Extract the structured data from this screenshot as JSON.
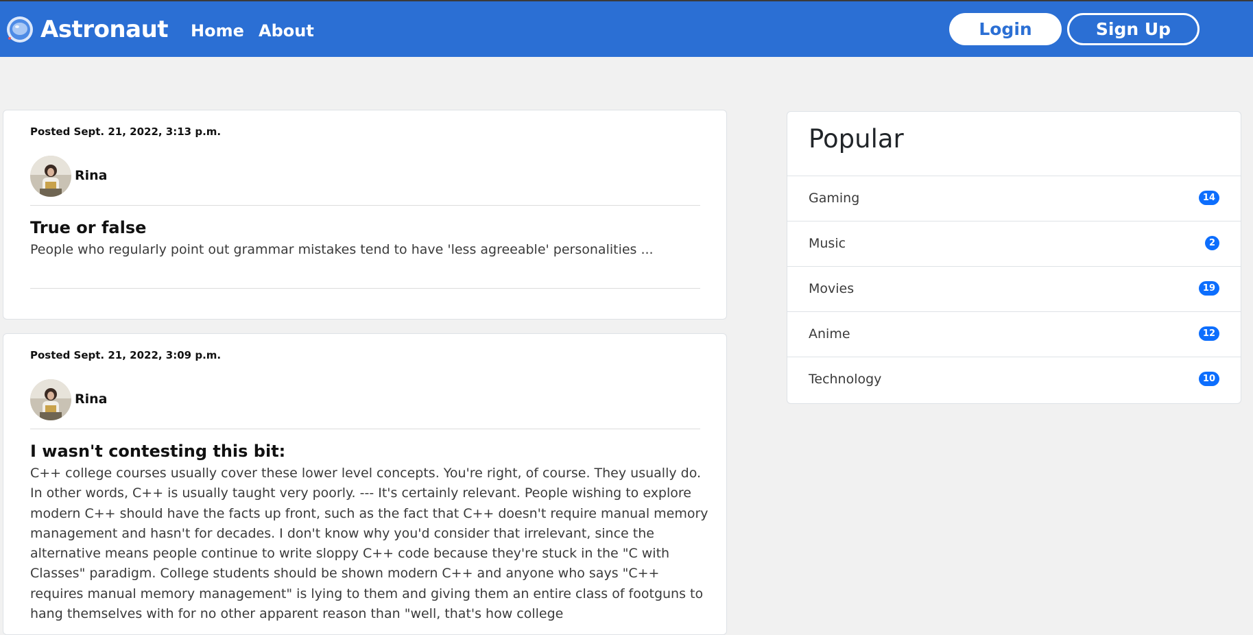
{
  "app": {
    "name": "Astronaut"
  },
  "nav": {
    "links": [
      "Home",
      "About"
    ],
    "login_label": "Login",
    "signup_label": "Sign Up"
  },
  "posts": [
    {
      "posted": "Posted Sept. 21, 2022, 3:13 p.m.",
      "author": "Rina",
      "title": "True or false",
      "body": "People who regularly point out grammar mistakes tend to have 'less agreeable' personalities ..."
    },
    {
      "posted": "Posted Sept. 21, 2022, 3:09 p.m.",
      "author": "Rina",
      "title": "I wasn't contesting this bit:",
      "body": "C++ college courses usually cover these lower level concepts. You're right, of course. They usually do. In other words, C++ is usually taught very poorly. --- It's certainly relevant. People wishing to explore modern C++ should have the facts up front, such as the fact that C++ doesn't require manual memory management and hasn't for decades. I don't know why you'd consider that irrelevant, since the alternative means people continue to write sloppy C++ code because they're stuck in the \"C with Classes\" paradigm. College students should be shown modern C++ and anyone who says \"C++ requires manual memory management\" is lying to them and giving them an entire class of footguns to hang themselves with for no other apparent reason than \"well, that's how college"
    }
  ],
  "popular": {
    "title": "Popular",
    "items": [
      {
        "name": "Gaming",
        "count": "14"
      },
      {
        "name": "Music",
        "count": "2"
      },
      {
        "name": "Movies",
        "count": "19"
      },
      {
        "name": "Anime",
        "count": "12"
      },
      {
        "name": "Technology",
        "count": "10"
      }
    ]
  },
  "colors": {
    "navbar": "#2b6fd4",
    "badge": "#0d6efd",
    "background": "#f1f1f1"
  },
  "icons": {
    "logo": "astronaut-helmet-icon",
    "avatar": "user-avatar-photo"
  }
}
